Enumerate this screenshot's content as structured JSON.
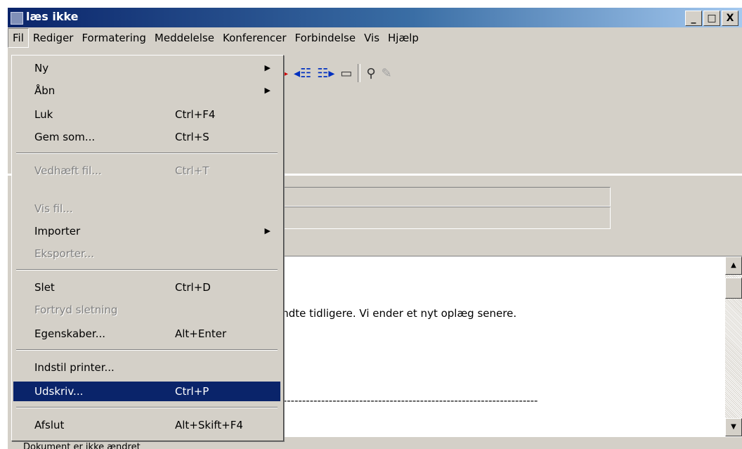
{
  "window": {
    "title": "læs ikke",
    "btn_minimize": "_",
    "btn_maximize": "□",
    "btn_close": "X"
  },
  "menubar": [
    "Fil",
    "Rediger",
    "Formatering",
    "Meddelelse",
    "Konferencer",
    "Forbindelse",
    "Vis",
    "Hjælp"
  ],
  "file_menu": {
    "items": [
      {
        "label": "Ny",
        "shortcut": "",
        "submenu": true,
        "disabled": false
      },
      {
        "label": "Åbn",
        "shortcut": "",
        "submenu": true,
        "disabled": false
      },
      {
        "label": "Luk",
        "shortcut": "Ctrl+F4",
        "submenu": false,
        "disabled": false
      },
      {
        "label": "Gem som...",
        "shortcut": "Ctrl+S",
        "submenu": false,
        "disabled": false
      },
      {
        "label": "Vedhæft fil...",
        "shortcut": "Ctrl+T",
        "submenu": false,
        "disabled": true
      },
      {
        "label": "Vis fil...",
        "shortcut": "",
        "submenu": false,
        "disabled": true
      },
      {
        "label": "Importer",
        "shortcut": "",
        "submenu": true,
        "disabled": false
      },
      {
        "label": "Eksporter...",
        "shortcut": "",
        "submenu": false,
        "disabled": true
      },
      {
        "label": "Slet",
        "shortcut": "Ctrl+D",
        "submenu": false,
        "disabled": false
      },
      {
        "label": "Fortryd sletning",
        "shortcut": "",
        "submenu": false,
        "disabled": true
      },
      {
        "label": "Egenskaber...",
        "shortcut": "Alt+Enter",
        "submenu": false,
        "disabled": false
      },
      {
        "label": "Indstil printer...",
        "shortcut": "",
        "submenu": false,
        "disabled": false
      },
      {
        "label": "Udskriv...",
        "shortcut": "Ctrl+P",
        "submenu": false,
        "disabled": false,
        "selected": true
      },
      {
        "label": "Afslut",
        "shortcut": "Alt+Skift+F4",
        "submenu": false,
        "disabled": false
      }
    ],
    "submenu_arrow": "▶"
  },
  "toolbar_icons": [
    "red-arrow-icon",
    "prev-message-icon",
    "next-message-icon",
    "folder-icon",
    "search-icon",
    "tools-icon"
  ],
  "message": {
    "body_line": "endte tidligere. Vi ender et nyt oplæg senere.",
    "divider": "---------------------------------------------------------------------"
  },
  "scrollbar": {
    "up": "▲",
    "down": "▼"
  },
  "status": "Dokument er ikke ændret"
}
